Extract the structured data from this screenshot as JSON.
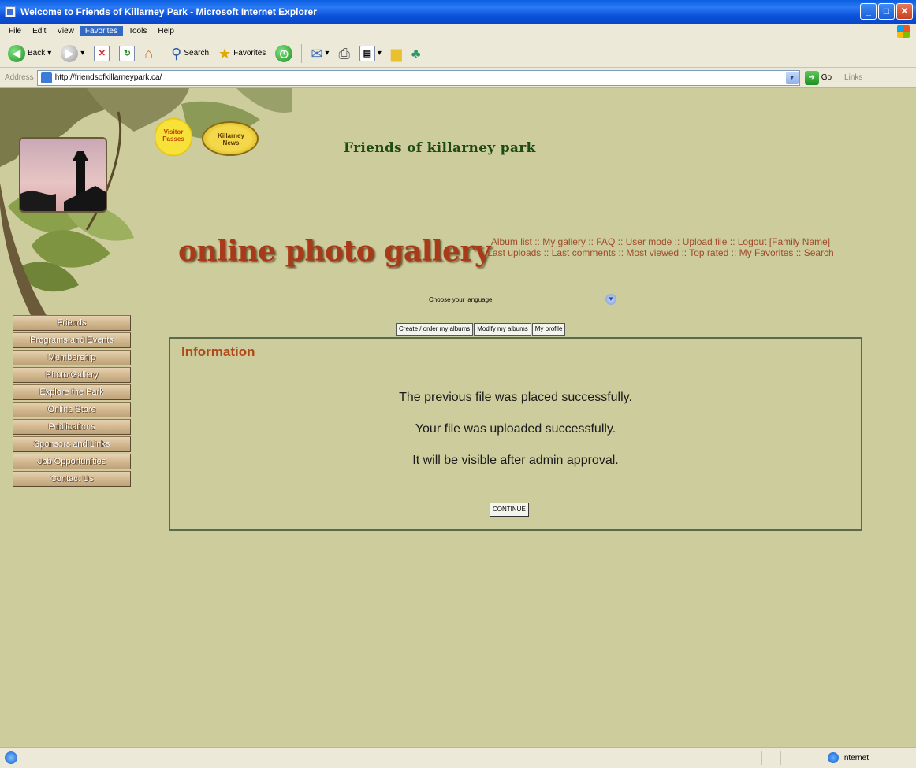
{
  "window": {
    "title": "Welcome to Friends of Killarney Park - Microsoft Internet Explorer",
    "min_label": "_",
    "max_label": "□",
    "close_label": "✕"
  },
  "menubar": {
    "items": [
      "File",
      "Edit",
      "View",
      "Favorites",
      "Tools",
      "Help"
    ],
    "active": "Favorites"
  },
  "toolbar": {
    "back_label": "Back",
    "search_label": "Search",
    "favorites_label": "Favorites"
  },
  "address": {
    "label": "Address",
    "url": "http://friendsofkillarneypark.ca/",
    "go_label": "Go",
    "links_label": "Links"
  },
  "header": {
    "site_title": "Friends of killarney park",
    "gallery_title": "online photo gallery",
    "badge_sun": "Visitor Passes",
    "badge_oval": "Killarney News"
  },
  "toplinks": {
    "row1": [
      "Album list",
      "My gallery",
      "FAQ",
      "User mode",
      "Upload file",
      "Logout [Family Name]"
    ],
    "row2": [
      "Last uploads",
      "Last comments",
      "Most viewed",
      "Top rated",
      "My Favorites",
      "Search"
    ],
    "separator": "::"
  },
  "language": {
    "label": "Choose your language"
  },
  "tabs": [
    "Create / order my albums",
    "Modify my albums",
    "My profile"
  ],
  "sidebar": {
    "items": [
      "Friends",
      "Programs and Events",
      "Membership",
      "Photo Gallery",
      "Explore the Park",
      "Online Store",
      "Publications",
      "Sponsors and Links",
      "Job Opportunities",
      "Contact Us"
    ]
  },
  "info": {
    "title": "Information",
    "messages": [
      "The previous file was placed successfully.",
      "Your file was uploaded successfully.",
      "It will be visible after admin approval."
    ],
    "continue_label": "CONTINUE"
  },
  "status": {
    "zone": "Internet"
  },
  "colors": {
    "page_bg": "#cdcc9d",
    "link": "#a04a2a",
    "heading": "#b04818",
    "site_title": "#1e4a14"
  }
}
